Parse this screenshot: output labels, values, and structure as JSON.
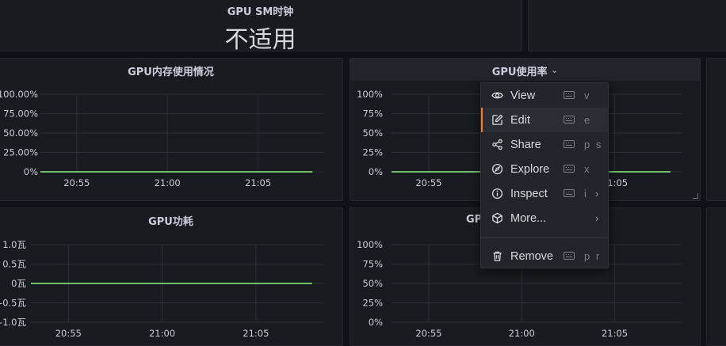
{
  "panels": {
    "sm_clock": {
      "title": "GPU SM时钟",
      "value": "不适用"
    },
    "memory": {
      "title": "GPU内存使用情况"
    },
    "utilization": {
      "title": "GPU使用率",
      "title_chevron": "⌄"
    },
    "power": {
      "title": "GPU功耗"
    },
    "bottom_mid": {
      "title": "GP"
    }
  },
  "menu": {
    "items": [
      {
        "label": "View",
        "icon": "eye-icon",
        "shortcut": "v"
      },
      {
        "label": "Edit",
        "icon": "edit-icon",
        "shortcut": "e",
        "active": true
      },
      {
        "label": "Share",
        "icon": "share-icon",
        "shortcut": "p s"
      },
      {
        "label": "Explore",
        "icon": "compass-icon",
        "shortcut": "x"
      },
      {
        "label": "Inspect",
        "icon": "info-icon",
        "shortcut": "i",
        "submenu": true
      },
      {
        "label": "More...",
        "icon": "cube-icon",
        "submenu": true
      }
    ],
    "remove": {
      "label": "Remove",
      "icon": "trash-icon",
      "shortcut": "p r"
    },
    "chevron": "›"
  },
  "colors": {
    "background": "#111217",
    "panel": "#181b1f",
    "series_line": "#73bf69",
    "active_accent": "#ff7a1a",
    "grid": "#2c3036"
  },
  "chart_data": [
    {
      "type": "line",
      "title": "GPU内存使用情况",
      "y_ticks": [
        "100.00%",
        "75.00%",
        "50.00%",
        "25.00%",
        "0%"
      ],
      "x_ticks": [
        "20:55",
        "21:00",
        "21:05"
      ],
      "ylim": [
        0,
        100
      ],
      "series": [
        {
          "x": [
            "20:53",
            "21:08"
          ],
          "values": [
            0,
            0
          ]
        }
      ]
    },
    {
      "type": "line",
      "title": "GPU使用率",
      "y_ticks": [
        "100%",
        "75%",
        "50%",
        "25%",
        "0%"
      ],
      "x_ticks": [
        "20:55",
        "21:00",
        "21:05"
      ],
      "ylim": [
        0,
        100
      ],
      "series": [
        {
          "x": [
            "20:53",
            "21:08"
          ],
          "values": [
            0,
            0
          ]
        }
      ]
    },
    {
      "type": "line",
      "title": "GPU功耗",
      "y_ticks": [
        "1.0瓦",
        "0.5瓦",
        "0瓦",
        "-0.5瓦",
        "-1.0瓦"
      ],
      "x_ticks": [
        "20:55",
        "21:00",
        "21:05"
      ],
      "ylim": [
        -1,
        1
      ],
      "series": [
        {
          "x": [
            "20:53",
            "21:08"
          ],
          "values": [
            0,
            0
          ]
        }
      ]
    },
    {
      "type": "line",
      "title": "GP",
      "y_ticks": [
        "100%",
        "75%",
        "50%",
        "25%",
        "0%"
      ],
      "x_ticks": [
        "20:55",
        "21:00",
        "21:05"
      ],
      "ylim": [
        0,
        100
      ],
      "series": []
    }
  ]
}
